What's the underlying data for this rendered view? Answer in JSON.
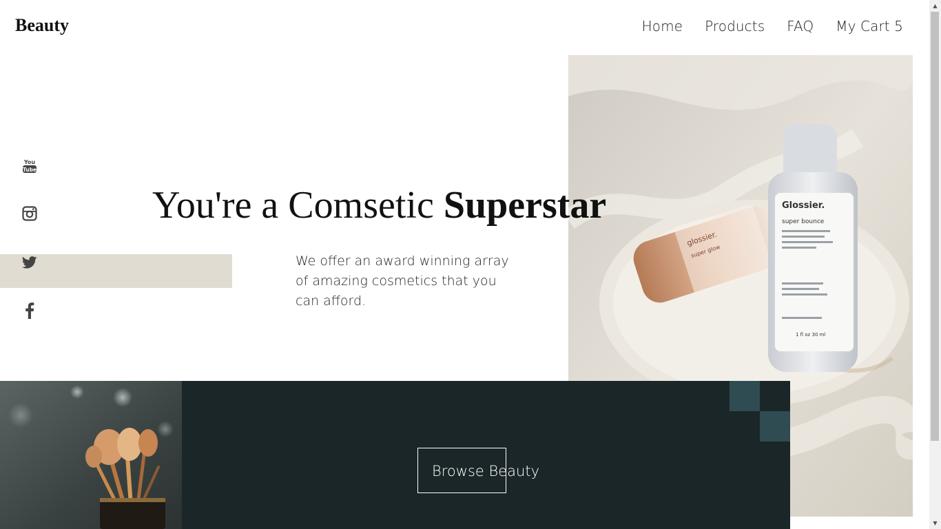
{
  "brand": {
    "logo": "Beauty"
  },
  "nav": [
    {
      "label": "Home"
    },
    {
      "label": "Products"
    },
    {
      "label": "FAQ"
    },
    {
      "label": "My Cart 5"
    }
  ],
  "social": [
    {
      "icon": "youtube-icon",
      "glyph": "You Tube"
    },
    {
      "icon": "instagram-icon"
    },
    {
      "icon": "twitter-icon"
    },
    {
      "icon": "facebook-icon",
      "glyph": "f"
    }
  ],
  "hero": {
    "headline_regular": "You're a Comsetic ",
    "headline_bold": "Superstar",
    "tagline": "We offer an award winning array of amazing cosmetics that you can afford.",
    "product_label_1": "Glossier.",
    "product_label_2": "glossier.",
    "product_caption_1": "super bounce",
    "product_caption_2": "super glow",
    "product_volume": "1 fl oz 30 ml"
  },
  "cta": {
    "label": "Browse Beauty"
  },
  "colors": {
    "dark_panel": "#1b2629",
    "accent_square": "#2f4c52",
    "beige_band": "#e0dcd2",
    "social_icon": "#444444"
  }
}
